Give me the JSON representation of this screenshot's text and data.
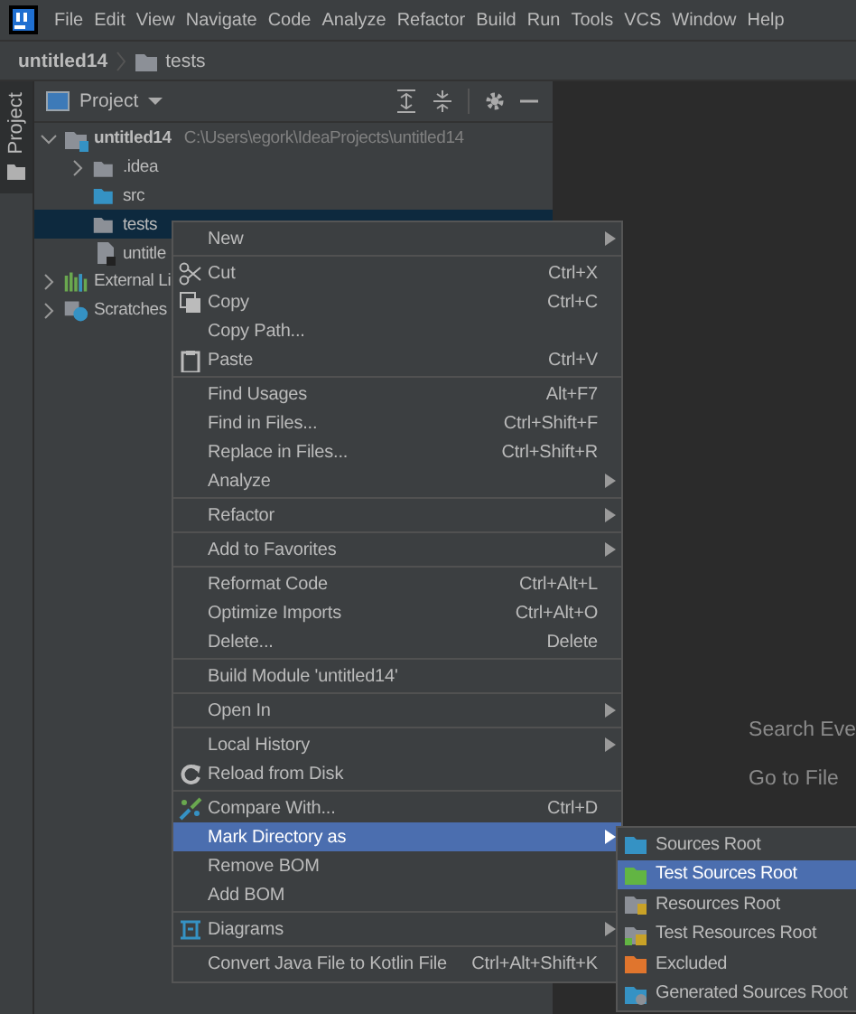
{
  "menu_bar": [
    "File",
    "Edit",
    "View",
    "Navigate",
    "Code",
    "Analyze",
    "Refactor",
    "Build",
    "Run",
    "Tools",
    "VCS",
    "Window",
    "Help"
  ],
  "breadcrumbs": [
    "untitled14",
    "tests"
  ],
  "side_tab": {
    "label": "Project",
    "selected": true
  },
  "project_panel": {
    "title": "Project",
    "tree": [
      {
        "label": "untitled14",
        "path": "C:\\Users\\egork\\IdeaProjects\\untitled14",
        "expanded": true,
        "selected": false,
        "children": [
          {
            "label": ".idea",
            "expanded": false,
            "selected": false
          },
          {
            "label": "src",
            "selected": false
          },
          {
            "label": "tests",
            "selected": true
          },
          {
            "label": "untitle",
            "selected": false
          }
        ]
      },
      {
        "label": "External Li",
        "expanded": false,
        "selected": false
      },
      {
        "label": "Scratches",
        "expanded": false,
        "selected": false
      }
    ]
  },
  "editor_hints": [
    "Search Eve",
    "Go to File"
  ],
  "context_menu": [
    {
      "kind": "item",
      "label": "New",
      "submenu": true,
      "selected": false
    },
    {
      "kind": "separator"
    },
    {
      "kind": "item",
      "label": "Cut",
      "shortcut": "Ctrl+X",
      "selected": false
    },
    {
      "kind": "item",
      "label": "Copy",
      "shortcut": "Ctrl+C",
      "selected": false
    },
    {
      "kind": "item",
      "label": "Copy Path...",
      "selected": false
    },
    {
      "kind": "item",
      "label": "Paste",
      "shortcut": "Ctrl+V",
      "selected": false
    },
    {
      "kind": "separator"
    },
    {
      "kind": "item",
      "label": "Find Usages",
      "shortcut": "Alt+F7",
      "selected": false
    },
    {
      "kind": "item",
      "label": "Find in Files...",
      "shortcut": "Ctrl+Shift+F",
      "selected": false
    },
    {
      "kind": "item",
      "label": "Replace in Files...",
      "shortcut": "Ctrl+Shift+R",
      "selected": false
    },
    {
      "kind": "item",
      "label": "Analyze",
      "submenu": true,
      "selected": false
    },
    {
      "kind": "separator"
    },
    {
      "kind": "item",
      "label": "Refactor",
      "submenu": true,
      "selected": false
    },
    {
      "kind": "separator"
    },
    {
      "kind": "item",
      "label": "Add to Favorites",
      "submenu": true,
      "selected": false
    },
    {
      "kind": "separator"
    },
    {
      "kind": "item",
      "label": "Reformat Code",
      "shortcut": "Ctrl+Alt+L",
      "selected": false
    },
    {
      "kind": "item",
      "label": "Optimize Imports",
      "shortcut": "Ctrl+Alt+O",
      "selected": false
    },
    {
      "kind": "item",
      "label": "Delete...",
      "shortcut": "Delete",
      "selected": false
    },
    {
      "kind": "separator"
    },
    {
      "kind": "item",
      "label": "Build Module 'untitled14'",
      "selected": false
    },
    {
      "kind": "separator"
    },
    {
      "kind": "item",
      "label": "Open In",
      "submenu": true,
      "selected": false
    },
    {
      "kind": "separator"
    },
    {
      "kind": "item",
      "label": "Local History",
      "submenu": true,
      "selected": false
    },
    {
      "kind": "item",
      "label": "Reload from Disk",
      "selected": false
    },
    {
      "kind": "separator"
    },
    {
      "kind": "item",
      "label": "Compare With...",
      "shortcut": "Ctrl+D",
      "selected": false
    },
    {
      "kind": "item",
      "label": "Mark Directory as",
      "submenu": true,
      "selected": true
    },
    {
      "kind": "item",
      "label": "Remove BOM",
      "selected": false
    },
    {
      "kind": "item",
      "label": "Add BOM",
      "selected": false
    },
    {
      "kind": "separator"
    },
    {
      "kind": "item",
      "label": "Diagrams",
      "submenu": true,
      "selected": false
    },
    {
      "kind": "separator"
    },
    {
      "kind": "item",
      "label": "Convert Java File to Kotlin File",
      "shortcut": "Ctrl+Alt+Shift+K",
      "selected": false
    }
  ],
  "submenu": [
    {
      "label": "Sources Root",
      "selected": false
    },
    {
      "label": "Test Sources Root",
      "selected": true
    },
    {
      "label": "Resources Root",
      "selected": false
    },
    {
      "label": "Test Resources Root",
      "selected": false
    },
    {
      "label": "Excluded",
      "selected": false
    },
    {
      "label": "Generated Sources Root",
      "selected": false
    }
  ]
}
